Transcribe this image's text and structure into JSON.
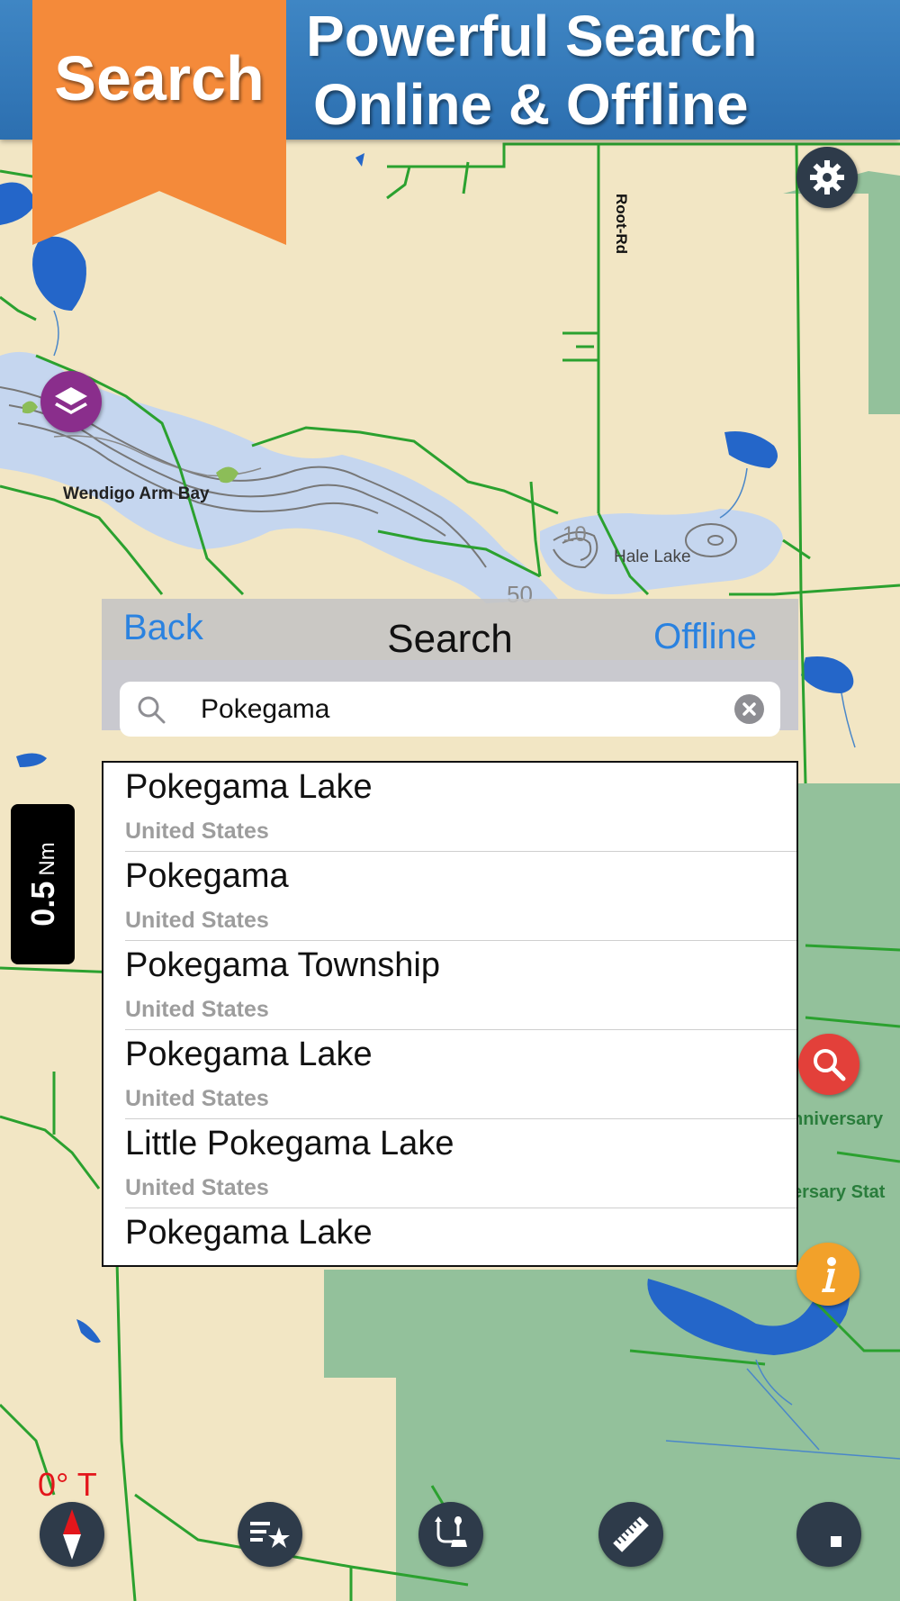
{
  "banner": {
    "ribbon_label": "Search",
    "headline_line1": "Powerful Search",
    "headline_line2": "Online & Offline"
  },
  "map": {
    "labels": {
      "bay": "Wendigo Arm Bay",
      "lake": "Hale Lake",
      "road": "Root-Rd",
      "anniversary_1": "nniversary",
      "anniversary_2": "ersary Stat",
      "contour_10": "10",
      "contour_50": "50"
    },
    "scale": {
      "value": "0.5",
      "unit": "Nm"
    },
    "heading": "0° T"
  },
  "search_panel": {
    "back_label": "Back",
    "title": "Search",
    "offline_label": "Offline",
    "query": "Pokegama",
    "results": [
      {
        "title": "Pokegama Lake",
        "subtitle": "United States"
      },
      {
        "title": "Pokegama",
        "subtitle": "United States"
      },
      {
        "title": "Pokegama Township",
        "subtitle": "United States"
      },
      {
        "title": "Pokegama Lake",
        "subtitle": "United States"
      },
      {
        "title": "Little Pokegama Lake",
        "subtitle": "United States"
      },
      {
        "title": "Pokegama Lake",
        "subtitle": ""
      }
    ]
  },
  "icons": {
    "settings": "gear-icon",
    "layers": "layers-icon",
    "search": "magnifier-icon",
    "info": "info-icon",
    "compass": "compass-icon",
    "favorites": "favorites-list-icon",
    "route": "route-icon",
    "measure": "ruler-icon",
    "record": "stop-icon"
  },
  "colors": {
    "land": "#f2e6c4",
    "water": "#c5d6ef",
    "deep_water": "#2466c9",
    "park": "#93c19b",
    "road": "#2ba12f",
    "banner_blue": "#2c6fb0",
    "ribbon_orange": "#f48a3a",
    "link_blue": "#2a82e0"
  }
}
